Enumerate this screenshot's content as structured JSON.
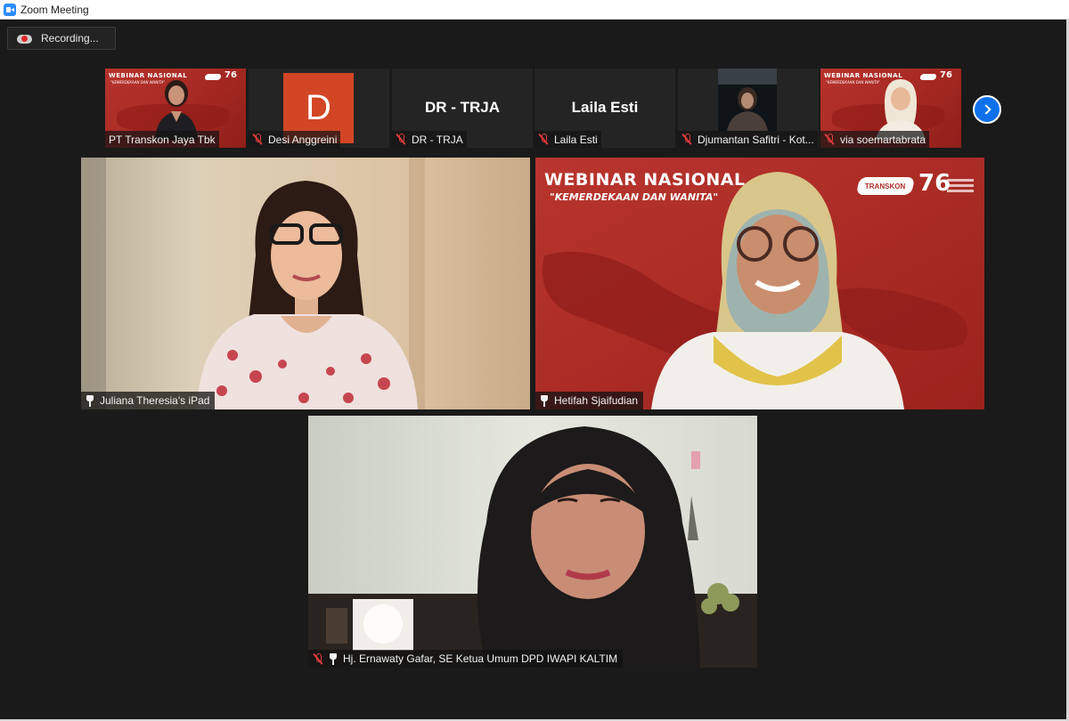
{
  "window": {
    "title": "Zoom Meeting"
  },
  "recording": {
    "label": "Recording..."
  },
  "strip": [
    {
      "name": "PT Transkon Jaya Tbk",
      "muted": false
    },
    {
      "name": "Desi Anggreini",
      "muted": true,
      "initial": "D"
    },
    {
      "name": "DR - TRJA",
      "muted": true,
      "display": "DR - TRJA"
    },
    {
      "name": "Laila Esti",
      "muted": true,
      "display": "Laila Esti"
    },
    {
      "name": "Djumantan Safitri - Kot...",
      "muted": true
    },
    {
      "name": "via soemartabrata",
      "muted": true
    }
  ],
  "webinar": {
    "title": "WEBINAR NASIONAL",
    "subtitle": "\"KEMERDEKAAN DAN WANITA\"",
    "badge": "76",
    "logo": "TRANSKON"
  },
  "gallery": [
    {
      "name": "Juliana Theresia's iPad",
      "pinned": true,
      "muted": false
    },
    {
      "name": "Hetifah Sjaifudian",
      "pinned": true,
      "muted": false
    },
    {
      "name": "Hj. Ernawaty Gafar, SE Ketua Umum DPD IWAPI KALTIM",
      "pinned": true,
      "muted": true
    }
  ],
  "colors": {
    "accent": "#0e71eb",
    "muted_icon": "#e23b3b",
    "avatar_bg": "#d24625",
    "webinar_red": "#b02e28"
  },
  "icons": {
    "next": "chevron-right-icon",
    "recording": "cloud-record-icon",
    "app": "zoom-camera-icon"
  }
}
